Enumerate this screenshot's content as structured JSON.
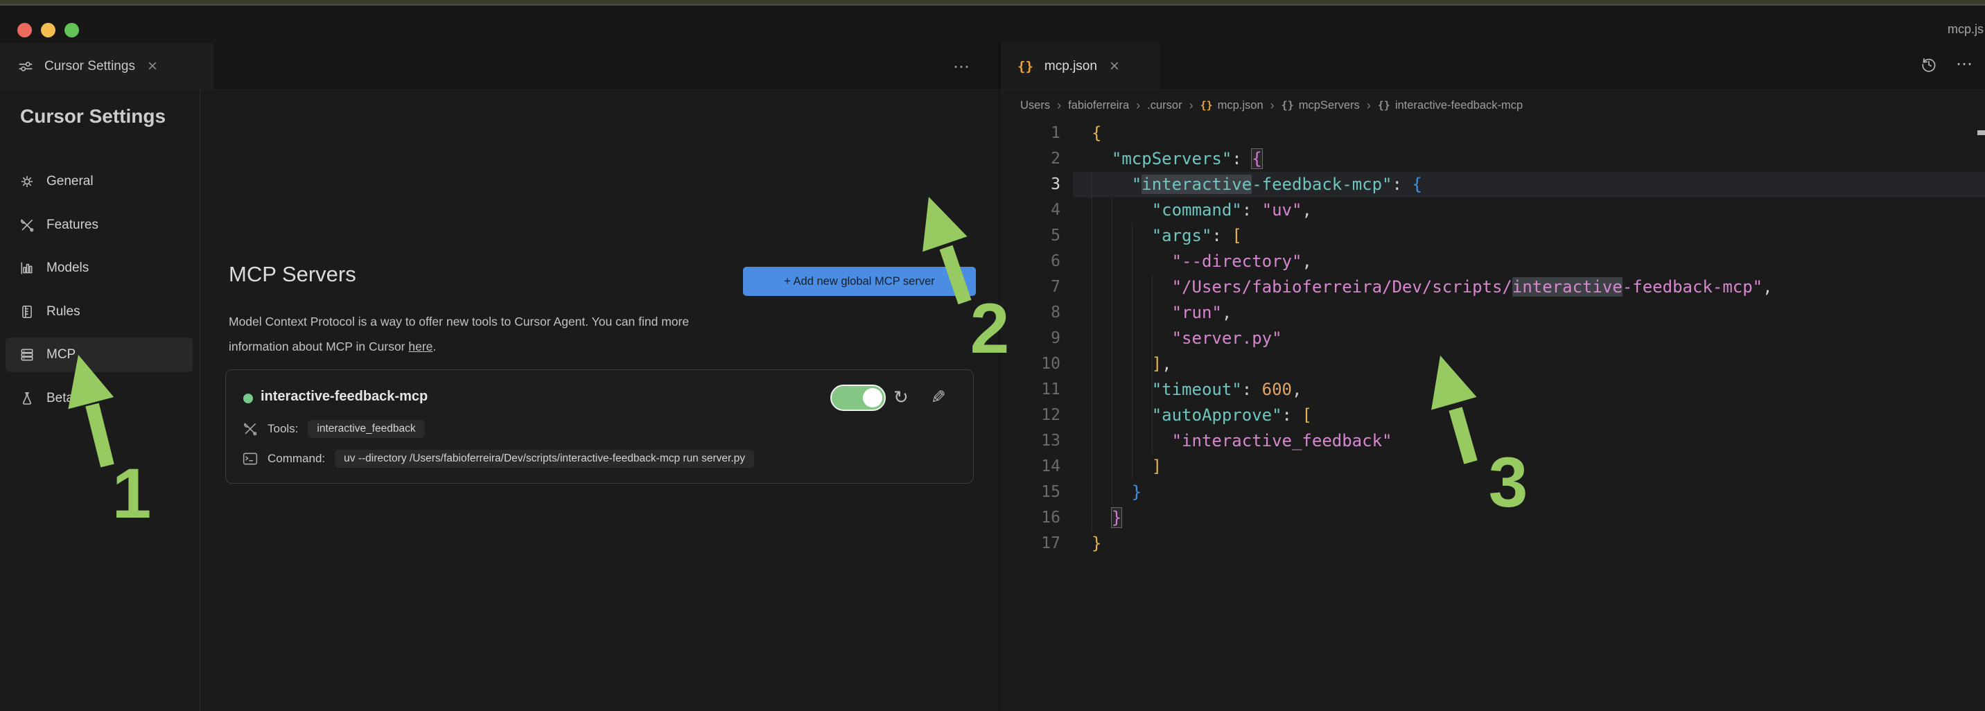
{
  "window": {
    "title_partial": "mcp.js",
    "traffic_lights": [
      "close",
      "minimize",
      "zoom"
    ]
  },
  "icons": {
    "close": "×",
    "more": "⋯",
    "refresh": "↻",
    "edit": "✎",
    "braces": "{}",
    "crumb_sep": "›"
  },
  "settings": {
    "tab_label": "Cursor Settings",
    "heading": "Cursor Settings",
    "sidebar": [
      {
        "id": "general",
        "label": "General",
        "icon": "gear",
        "selected": false
      },
      {
        "id": "features",
        "label": "Features",
        "icon": "tools",
        "selected": false
      },
      {
        "id": "models",
        "label": "Models",
        "icon": "chart",
        "selected": false
      },
      {
        "id": "rules",
        "label": "Rules",
        "icon": "rules",
        "selected": false
      },
      {
        "id": "mcp",
        "label": "MCP",
        "icon": "stack",
        "selected": true
      },
      {
        "id": "beta",
        "label": "Beta",
        "icon": "flask",
        "selected": false
      }
    ],
    "mcp": {
      "heading": "MCP Servers",
      "add_button": "+ Add new global MCP server",
      "desc_line1": "Model Context Protocol is a way to offer new tools to Cursor Agent. You can find more",
      "desc_line2_prefix": "information about MCP in Cursor ",
      "link_text": "here",
      "desc_line2_suffix": ".",
      "server": {
        "name": "interactive-feedback-mcp",
        "status_color": "#78c98c",
        "enabled": true,
        "tools_label": "Tools:",
        "tools_value": "interactive_feedback",
        "command_label": "Command:",
        "command_value": "uv --directory /Users/fabioferreira/Dev/scripts/interactive-feedback-mcp run server.py"
      }
    }
  },
  "editor": {
    "tab_label": "mcp.json",
    "breadcrumb": [
      {
        "label": "Users"
      },
      {
        "label": "fabioferreira"
      },
      {
        "label": ".cursor"
      },
      {
        "label": "mcp.json",
        "icon": "braces",
        "icon_color": "orange"
      },
      {
        "label": "mcpServers",
        "icon": "braces"
      },
      {
        "label": "interactive-feedback-mcp",
        "icon": "braces"
      }
    ],
    "code": {
      "language": "json",
      "current_line": 3,
      "colors": {
        "b1": "#e3b34f",
        "b2": "#d678d4",
        "b3": "#4290e2",
        "key": "#6fc5bf",
        "str": "#d787cf",
        "num": "#e2a566",
        "punc": "#cfcfcf"
      },
      "lines": [
        {
          "n": 1,
          "tokens": [
            [
              "{",
              "b1"
            ]
          ]
        },
        {
          "n": 2,
          "tokens": [
            [
              "  ",
              "punc"
            ],
            [
              "\"mcpServers\"",
              "key"
            ],
            [
              ": ",
              "punc"
            ],
            [
              "{",
              "b2 box"
            ]
          ]
        },
        {
          "n": 3,
          "tokens": [
            [
              "    ",
              "punc"
            ],
            [
              "\"",
              "key"
            ],
            [
              "interactive",
              "key hl"
            ],
            [
              "-feedback-mcp\"",
              "key"
            ],
            [
              ": ",
              "punc"
            ],
            [
              "{",
              "b3"
            ]
          ]
        },
        {
          "n": 4,
          "tokens": [
            [
              "      ",
              "punc"
            ],
            [
              "\"command\"",
              "key"
            ],
            [
              ": ",
              "punc"
            ],
            [
              "\"uv\"",
              "str"
            ],
            [
              ",",
              "punc"
            ]
          ]
        },
        {
          "n": 5,
          "tokens": [
            [
              "      ",
              "punc"
            ],
            [
              "\"args\"",
              "key"
            ],
            [
              ": ",
              "punc"
            ],
            [
              "[",
              "b1"
            ]
          ]
        },
        {
          "n": 6,
          "tokens": [
            [
              "        ",
              "punc"
            ],
            [
              "\"--directory\"",
              "str"
            ],
            [
              ",",
              "punc"
            ]
          ]
        },
        {
          "n": 7,
          "tokens": [
            [
              "        ",
              "punc"
            ],
            [
              "\"/Users/fabioferreira/Dev/scripts/",
              "str"
            ],
            [
              "interactive",
              "str hl"
            ],
            [
              "-feedback-mcp\"",
              "str"
            ],
            [
              ",",
              "punc"
            ]
          ]
        },
        {
          "n": 8,
          "tokens": [
            [
              "        ",
              "punc"
            ],
            [
              "\"run\"",
              "str"
            ],
            [
              ",",
              "punc"
            ]
          ]
        },
        {
          "n": 9,
          "tokens": [
            [
              "        ",
              "punc"
            ],
            [
              "\"server.py\"",
              "str"
            ]
          ]
        },
        {
          "n": 10,
          "tokens": [
            [
              "      ",
              "punc"
            ],
            [
              "]",
              "b1"
            ],
            [
              ",",
              "punc"
            ]
          ]
        },
        {
          "n": 11,
          "tokens": [
            [
              "      ",
              "punc"
            ],
            [
              "\"timeout\"",
              "key"
            ],
            [
              ": ",
              "punc"
            ],
            [
              "600",
              "num"
            ],
            [
              ",",
              "punc"
            ]
          ]
        },
        {
          "n": 12,
          "tokens": [
            [
              "      ",
              "punc"
            ],
            [
              "\"autoApprove\"",
              "key"
            ],
            [
              ": ",
              "punc"
            ],
            [
              "[",
              "b1"
            ]
          ]
        },
        {
          "n": 13,
          "tokens": [
            [
              "        ",
              "punc"
            ],
            [
              "\"interactive_feedback\"",
              "str"
            ]
          ]
        },
        {
          "n": 14,
          "tokens": [
            [
              "      ",
              "punc"
            ],
            [
              "]",
              "b1"
            ]
          ]
        },
        {
          "n": 15,
          "tokens": [
            [
              "    ",
              "punc"
            ],
            [
              "}",
              "b3"
            ]
          ]
        },
        {
          "n": 16,
          "tokens": [
            [
              "  ",
              "punc"
            ],
            [
              "}",
              "b2 box"
            ]
          ]
        },
        {
          "n": 17,
          "tokens": [
            [
              "}",
              "b1"
            ]
          ]
        }
      ]
    }
  },
  "annotations": {
    "color": "#97ca60",
    "numbers": [
      "1",
      "2",
      "3"
    ]
  }
}
